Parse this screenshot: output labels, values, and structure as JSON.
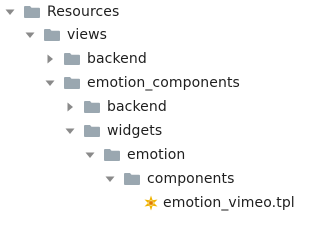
{
  "tree": {
    "resources": {
      "label": "Resources",
      "expanded": true,
      "icon": "folder-icon"
    },
    "views": {
      "label": "views",
      "expanded": true,
      "icon": "folder-icon"
    },
    "views_backend": {
      "label": "backend",
      "expanded": false,
      "icon": "folder-icon"
    },
    "emotion_components": {
      "label": "emotion_components",
      "expanded": true,
      "icon": "folder-icon"
    },
    "ec_backend": {
      "label": "backend",
      "expanded": false,
      "icon": "folder-icon"
    },
    "widgets": {
      "label": "widgets",
      "expanded": true,
      "icon": "folder-icon"
    },
    "emotion": {
      "label": "emotion",
      "expanded": true,
      "icon": "folder-icon"
    },
    "components": {
      "label": "components",
      "expanded": true,
      "icon": "folder-icon"
    },
    "file": {
      "label": "emotion_vimeo.tpl",
      "icon": "template-file-icon"
    }
  },
  "colors": {
    "arrow": "#8a8a8a",
    "folder": "#9aa7b0",
    "text": "#1e1e1e",
    "file_icon": "#f0b400"
  }
}
